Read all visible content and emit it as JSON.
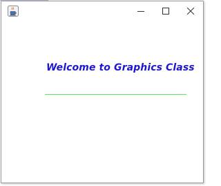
{
  "window": {
    "title": "",
    "icon": "java-coffee-cup-icon",
    "controls": {
      "minimize": "minimize-icon",
      "maximize": "maximize-icon",
      "close": "close-icon"
    }
  },
  "content": {
    "welcome_text": "Welcome to Graphics Class"
  },
  "colors": {
    "welcome_text": "#1f17cf",
    "underline": "#5ee35e",
    "background": "#ffffff"
  }
}
